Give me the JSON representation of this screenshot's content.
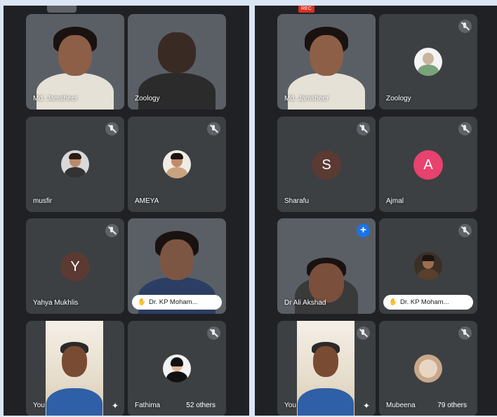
{
  "left": {
    "tiles": [
      {
        "name": "Md. Jamsheer"
      },
      {
        "name": "Zoology"
      },
      {
        "name": "musfir"
      },
      {
        "name": "AMEYA"
      },
      {
        "name": "Yahya Mukhlis",
        "initial": "Y"
      },
      {
        "name": "Dr. KP Moham..."
      },
      {
        "name": "You"
      },
      {
        "name": "Fathima",
        "others": "52 others"
      }
    ]
  },
  "right": {
    "tiles": [
      {
        "name": "Md. Jamsheer"
      },
      {
        "name": "Zoology"
      },
      {
        "name": "Sharafu",
        "initial": "S"
      },
      {
        "name": "Ajmal",
        "initial": "A"
      },
      {
        "name": "Dr Ali Akshad"
      },
      {
        "name": "Dr. KP Moham..."
      },
      {
        "name": "You"
      },
      {
        "name": "Mubeena",
        "others": "79 others"
      }
    ]
  },
  "colors": {
    "avatar_y": "#5b3a34",
    "avatar_s": "#5b3a34",
    "avatar_a": "#e8426e",
    "pin_blue": "#1a73e8",
    "rec_red": "#d93025"
  },
  "rec_label": "REC"
}
